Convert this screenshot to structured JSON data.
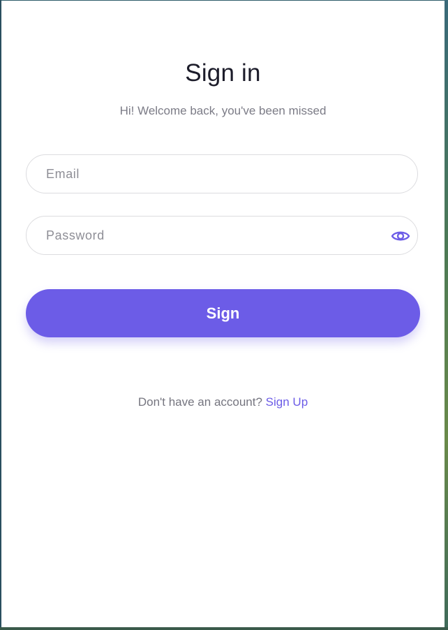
{
  "header": {
    "title": "Sign in",
    "subtitle": "Hi! Welcome back, you've been missed"
  },
  "form": {
    "email": {
      "placeholder": "Email",
      "value": ""
    },
    "password": {
      "placeholder": "Password",
      "value": "",
      "toggle_icon": "eye-icon"
    },
    "submit_label": "Sign"
  },
  "footer": {
    "prompt": "Don't have an account?",
    "link_label": "Sign Up"
  },
  "colors": {
    "accent": "#6c5ce7",
    "title": "#1c1c2a",
    "muted_text": "#7b7b86",
    "border": "#dcdcdf"
  }
}
